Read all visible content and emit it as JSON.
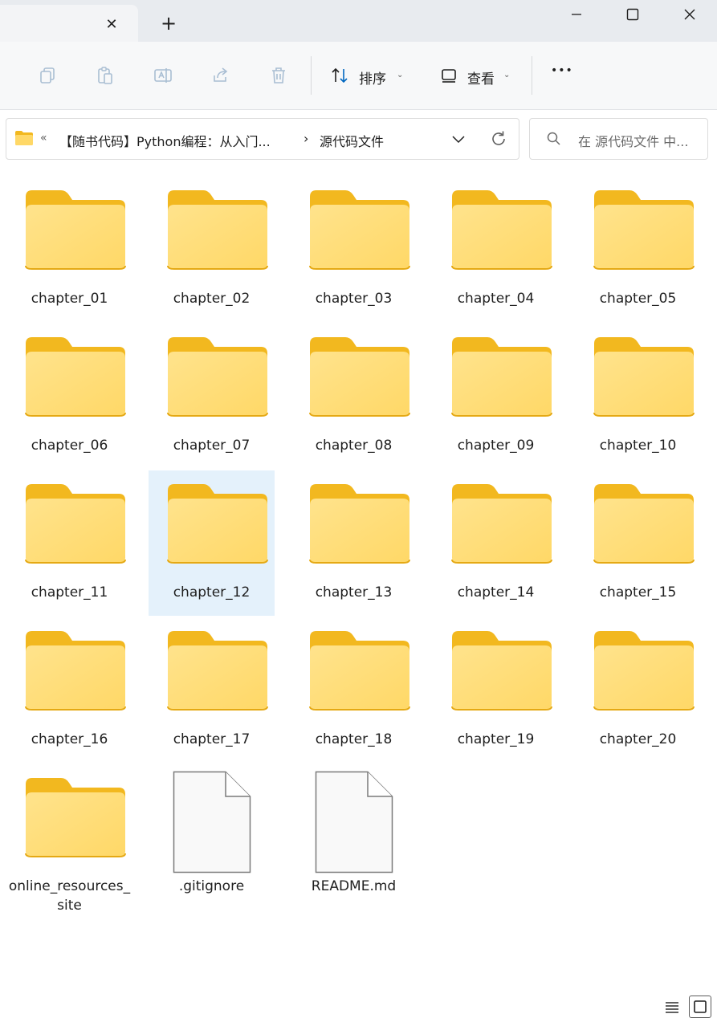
{
  "tab": {
    "close_glyph": "✕",
    "new_glyph": "+"
  },
  "window": {
    "minimize": "—",
    "maximize": "☐",
    "close": "✕"
  },
  "toolbar": {
    "sort_label": "排序",
    "view_label": "查看",
    "more_glyph": "•••"
  },
  "address": {
    "overflow": "«",
    "crumb1": "【随书代码】Python编程：从入门...",
    "separator": "›",
    "crumb2": "源代码文件"
  },
  "search": {
    "placeholder": "在 源代码文件 中..."
  },
  "items": [
    {
      "name": "chapter_01",
      "type": "folder"
    },
    {
      "name": "chapter_02",
      "type": "folder"
    },
    {
      "name": "chapter_03",
      "type": "folder"
    },
    {
      "name": "chapter_04",
      "type": "folder"
    },
    {
      "name": "chapter_05",
      "type": "folder"
    },
    {
      "name": "chapter_06",
      "type": "folder"
    },
    {
      "name": "chapter_07",
      "type": "folder"
    },
    {
      "name": "chapter_08",
      "type": "folder"
    },
    {
      "name": "chapter_09",
      "type": "folder"
    },
    {
      "name": "chapter_10",
      "type": "folder"
    },
    {
      "name": "chapter_11",
      "type": "folder"
    },
    {
      "name": "chapter_12",
      "type": "folder",
      "selected": true
    },
    {
      "name": "chapter_13",
      "type": "folder"
    },
    {
      "name": "chapter_14",
      "type": "folder"
    },
    {
      "name": "chapter_15",
      "type": "folder"
    },
    {
      "name": "chapter_16",
      "type": "folder"
    },
    {
      "name": "chapter_17",
      "type": "folder"
    },
    {
      "name": "chapter_18",
      "type": "folder"
    },
    {
      "name": "chapter_19",
      "type": "folder"
    },
    {
      "name": "chapter_20",
      "type": "folder"
    },
    {
      "name": "online_resources_site",
      "type": "folder"
    },
    {
      "name": ".gitignore",
      "type": "file"
    },
    {
      "name": "README.md",
      "type": "file"
    }
  ],
  "colors": {
    "folder_back": "#f2b81f",
    "folder_front": "#ffd867",
    "selection": "#e4f1fb",
    "accent": "#0067c0"
  }
}
